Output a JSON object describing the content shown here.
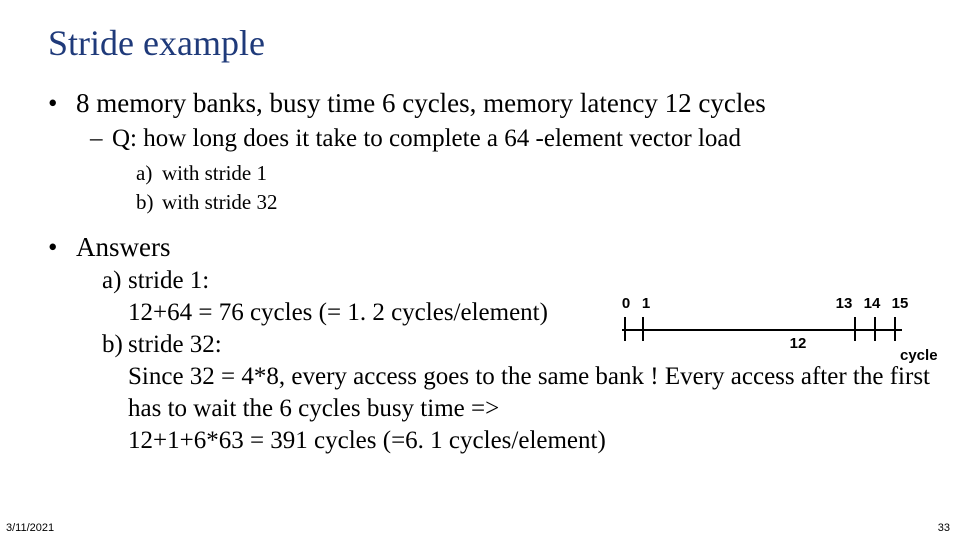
{
  "title": "Stride example",
  "bullet1": "8 memory banks, busy time 6 cycles, memory latency 12 cycles",
  "q_line": "Q: how long does it take to complete a 64 -element vector load",
  "q_a_label": "a)",
  "q_a_text": "with stride 1",
  "q_b_label": "b)",
  "q_b_text": "with stride 32",
  "answers_hdr": "Answers",
  "ans_a_label": "a)",
  "ans_a_line1": "stride 1:",
  "ans_a_line2": "12+64 = 76 cycles (= 1. 2 cycles/element)",
  "ans_b_label": "b)",
  "ans_b_line1": "stride 32:",
  "ans_b_line2": "Since 32 = 4*8, every access goes to the same bank ! Every access after the first has to wait the 6 cycles busy time =>",
  "ans_b_line3": "12+1+6*63 = 391 cycles (=6. 1 cycles/element)",
  "timeline": {
    "tick_top_labels": [
      "0",
      "1",
      "13",
      "14",
      "15"
    ],
    "mid_label": "12",
    "axis_label": "cycle"
  },
  "footer": {
    "date": "3/11/2021",
    "page": "33"
  },
  "chart_data": {
    "type": "line",
    "title": "memory access timeline (cycles)",
    "xlabel": "cycle",
    "ylabel": "",
    "tick_positions_shown": [
      0,
      1,
      13,
      14,
      15
    ],
    "midpoint_annotation": 12,
    "x_range": [
      0,
      15
    ]
  }
}
